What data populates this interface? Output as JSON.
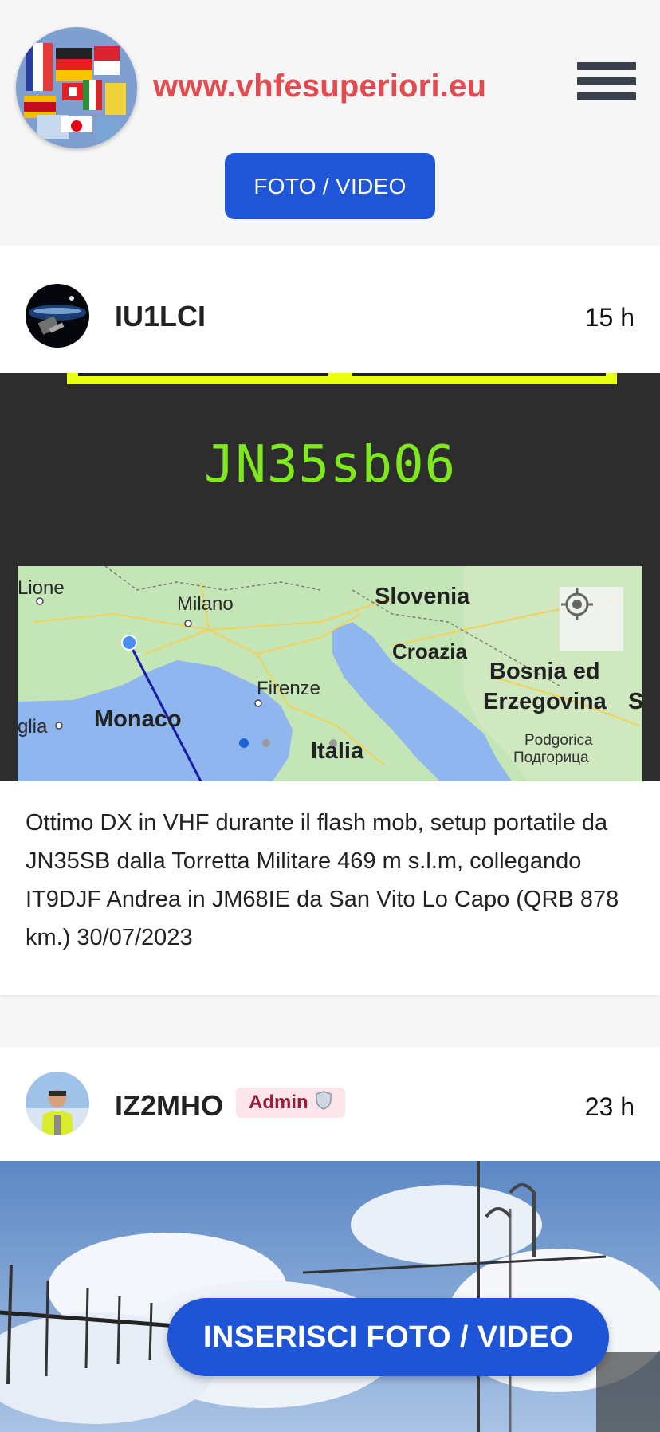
{
  "header": {
    "site_title": "www.vhfesuperiori.eu",
    "top_button": "FOTO / VIDEO"
  },
  "posts": [
    {
      "username": "IU1LCI",
      "time": "15 h",
      "locator": "JN35sb06",
      "map_labels": {
        "lione": "Lione",
        "milano": "Milano",
        "slovenia": "Slovenia",
        "croazia": "Croazia",
        "bosnia_1": "Bosnia ed",
        "bosnia_2": "Erzegovina",
        "bosnia_s": "S",
        "firenze": "Firenze",
        "monaco": "Monaco",
        "glia": "glia",
        "italia": "Italia",
        "podgorica": "Podgorica",
        "podgorica_cyr": "Подгорица"
      },
      "text": "Ottimo DX in VHF durante il flash mob, setup portatile da JN35SB dalla Torretta Militare 469 m s.l.m, collegando IT9DJF Andrea in JM68IE da San Vito Lo Capo (QRB 878 km.) 30/07/2023"
    },
    {
      "username": "IZ2MHO",
      "badge": "Admin",
      "time": "23 h"
    }
  ],
  "fab_label": "INSERISCI FOTO / VIDEO",
  "colors": {
    "site_title": "#e4494d",
    "button_blue": "#1f56d8",
    "locator_green": "#7fe81e",
    "yellow_bar": "#e9ff12"
  },
  "icons": [
    "hamburger-menu-icon",
    "shield-icon",
    "locate-target-icon"
  ]
}
